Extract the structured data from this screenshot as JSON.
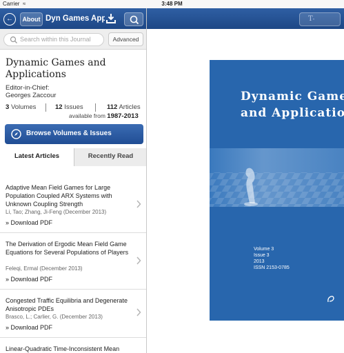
{
  "status": {
    "carrier": "Carrier",
    "time": "3:48 PM"
  },
  "navbar": {
    "about": "About",
    "title": "Dyn Games Appl"
  },
  "search": {
    "placeholder": "Search within this Journal",
    "advanced": "Advanced"
  },
  "journal": {
    "title": "Dynamic Games and Applications",
    "editor_label": "Editor-in-Chief:",
    "editor_name": "Georges Zaccour",
    "volumes_count": "3",
    "volumes_label": "Volumes",
    "issues_count": "12",
    "issues_label": "Issues",
    "articles_count": "112",
    "articles_label": "Articles",
    "available_label": "available from",
    "available_range": "1987-2013"
  },
  "browse_button": "Browse Volumes & Issues",
  "tabs": {
    "latest": "Latest Articles",
    "recent": "Recently Read"
  },
  "articles": [
    {
      "title": "Adaptive Mean Field Games for Large Population Coupled ARX Systems with Unknown Coupling Strength",
      "meta": "Li, Tao; Zhang, Ji-Feng (December 2013)",
      "download": "Download PDF"
    },
    {
      "title": "The Derivation of Ergodic Mean Field Game Equations for Several Populations of Players",
      "meta": "Feleqi, Ermal (December 2013)",
      "download": "Download PDF"
    },
    {
      "title": "Congested Traffic Equilibria and Degenerate Anisotropic PDEs",
      "meta": "Brasco, L.; Carlier, G. (December 2013)",
      "download": "Download PDF"
    },
    {
      "title": "Linear-Quadratic Time-Inconsistent Mean Field Games",
      "meta": "",
      "download": ""
    }
  ],
  "reader": {
    "text_size_button": "T",
    "cover_title": "Dynamic Games\nand Applications",
    "cover_volume": "Volume 3",
    "cover_issue": "Issue 3",
    "cover_year": "2013",
    "cover_issn": "ISSN 2153-0785"
  },
  "colors": {
    "nav_blue": "#1d4786",
    "cover_blue": "#2866ad",
    "button_blue": "#204d94"
  }
}
